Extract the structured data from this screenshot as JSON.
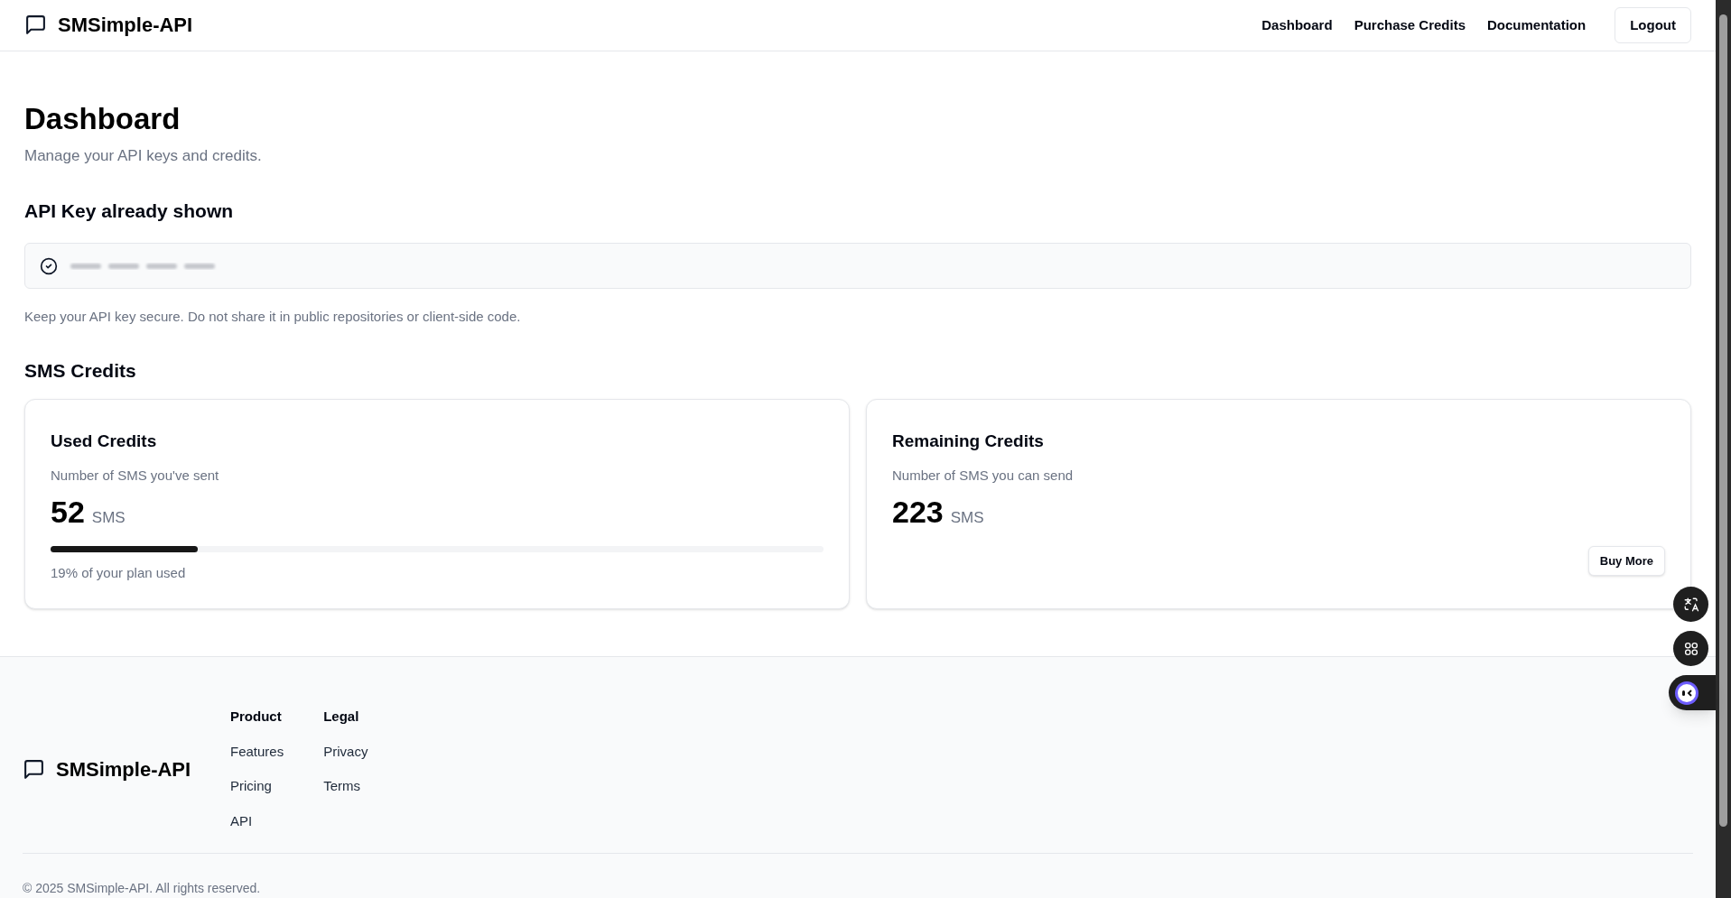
{
  "header": {
    "brand": "SMSimple-API",
    "nav": [
      {
        "label": "Dashboard"
      },
      {
        "label": "Purchase Credits"
      },
      {
        "label": "Documentation"
      }
    ],
    "logout": "Logout"
  },
  "page": {
    "title": "Dashboard",
    "subtitle": "Manage your API keys and credits."
  },
  "api_key": {
    "heading": "API Key already shown",
    "note": "Keep your API key secure. Do not share it in public repositories or client-side code."
  },
  "credits": {
    "heading": "SMS Credits",
    "cards": [
      {
        "kind": "used",
        "title": "Used Credits",
        "description": "Number of SMS you've sent",
        "value": "52",
        "unit": "SMS",
        "level": 0.19,
        "caption": "19% of your plan used"
      },
      {
        "kind": "remaining",
        "title": "Remaining Credits",
        "description": "Number of SMS you can send",
        "value": "223",
        "unit": "SMS",
        "button": "Buy More"
      }
    ]
  },
  "footer": {
    "brand": "SMSimple-API",
    "columns": [
      {
        "heading": "Product",
        "links": [
          "Features",
          "Pricing",
          "API"
        ]
      },
      {
        "heading": "Legal",
        "links": [
          "Privacy",
          "Terms"
        ]
      }
    ],
    "copyright": "© 2025 SMSimple-API. All rights reserved."
  }
}
